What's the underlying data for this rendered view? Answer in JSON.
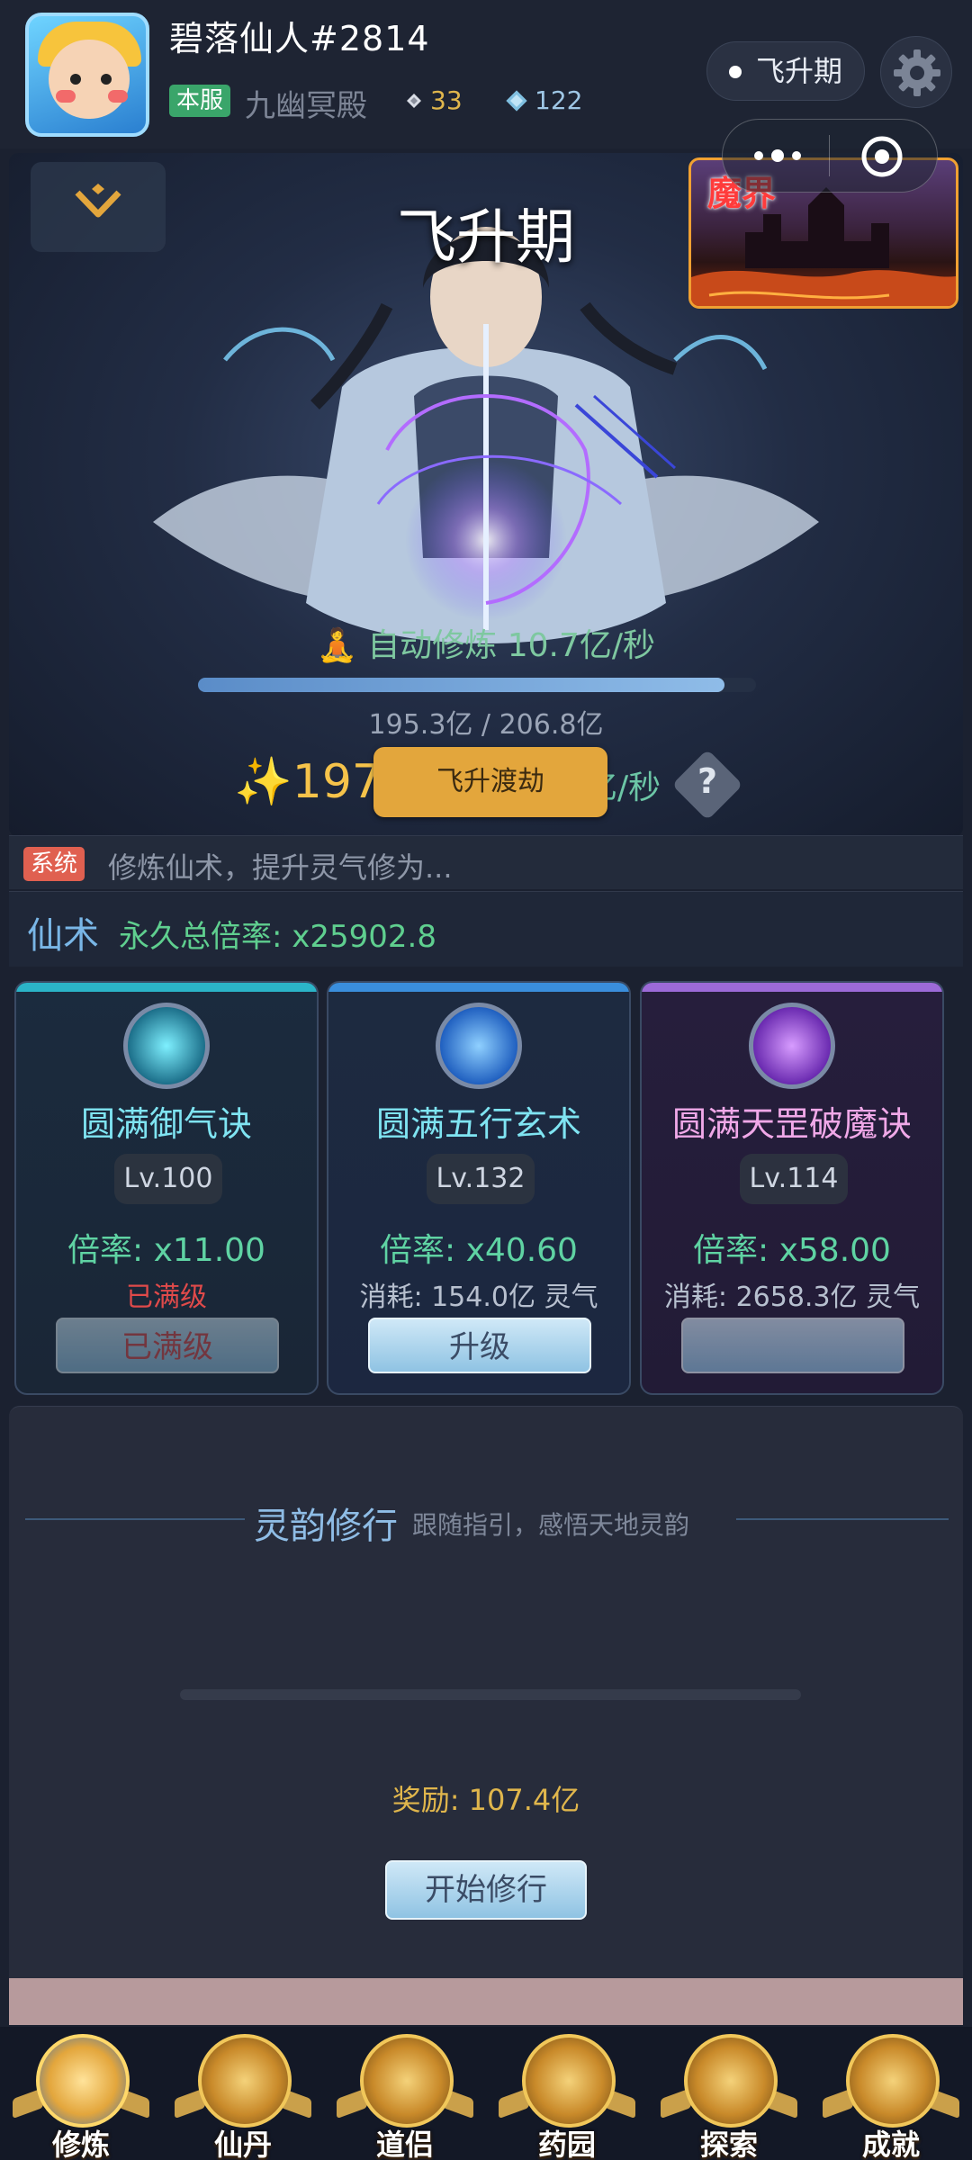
{
  "header": {
    "player_name": "碧落仙人#2814",
    "server_badge": "本服",
    "sect_name": "九幽冥殿",
    "resource_1": "33",
    "resource_2": "122",
    "realm_pill": "飞升期"
  },
  "hero": {
    "realm_title": "飞升期",
    "magic_world_label": "魔界",
    "auto_cultivate": "自动修炼 10.7亿/秒",
    "progress_text": "195.3亿 / 206.8亿",
    "progress_fraction": 0.944,
    "rate_value": "✨197",
    "rate_suffix": "亿/秒",
    "ascend_button": "飞升渡劫"
  },
  "system": {
    "tag": "系统",
    "message": "修炼仙术，提升灵气修为..."
  },
  "arts": {
    "title": "仙术",
    "multiplier": "永久总倍率: x25902.8",
    "cards": [
      {
        "name": "圆满御气诀",
        "level": "Lv.100",
        "multiplier": "倍率: x11.00",
        "status": "已满级",
        "button": "已满级"
      },
      {
        "name": "圆满五行玄术",
        "level": "Lv.132",
        "multiplier": "倍率: x40.60",
        "status": "消耗: 154.0亿 灵气",
        "button": "升级"
      },
      {
        "name": "圆满天罡破魔诀",
        "level": "Lv.114",
        "multiplier": "倍率: x58.00",
        "status": "消耗: 2658.3亿 灵气",
        "button": ""
      }
    ]
  },
  "practice": {
    "title": "灵韵修行",
    "subtitle": "跟随指引，感悟天地灵韵",
    "reward": "奖励: 107.4亿",
    "start_button": "开始修行"
  },
  "nav": {
    "items": [
      {
        "label": "修炼",
        "icon": "meditation-icon"
      },
      {
        "label": "仙丹",
        "icon": "elixir-icon"
      },
      {
        "label": "道侣",
        "icon": "companion-icon"
      },
      {
        "label": "药园",
        "icon": "herb-garden-icon"
      },
      {
        "label": "探索",
        "icon": "compass-icon"
      },
      {
        "label": "成就",
        "icon": "trophy-icon"
      }
    ]
  },
  "colors": {
    "accent_gold": "#e3a63c",
    "green_text": "#5fcf8f",
    "maxed_red": "#e04a4a",
    "card_teal": "#2bb4c8",
    "card_blue": "#3a8edc",
    "card_purple": "#9c6ad8"
  }
}
